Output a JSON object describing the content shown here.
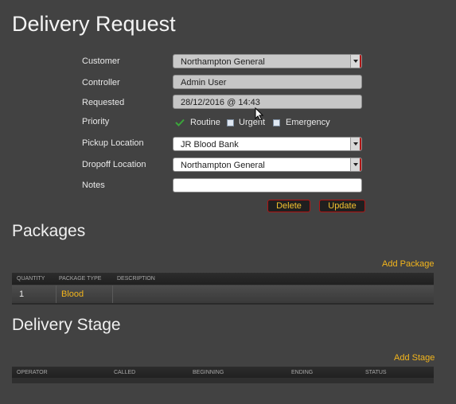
{
  "page": {
    "title": "Delivery Request"
  },
  "form": {
    "customer": {
      "label": "Customer",
      "value": "Northampton General"
    },
    "controller": {
      "label": "Controller",
      "value": "Admin User"
    },
    "requested": {
      "label": "Requested",
      "value": "28/12/2016 @ 14:43"
    },
    "priority": {
      "label": "Priority",
      "options": [
        "Routine",
        "Urgent",
        "Emergency"
      ],
      "selected": "Routine"
    },
    "pickup": {
      "label": "Pickup Location",
      "value": "JR Blood Bank"
    },
    "dropoff": {
      "label": "Dropoff Location",
      "value": "Northampton General"
    },
    "notes": {
      "label": "Notes",
      "value": ""
    },
    "delete_label": "Delete",
    "update_label": "Update"
  },
  "packages": {
    "title": "Packages",
    "add_label": "Add Package",
    "columns": [
      "QUANTITY",
      "PACKAGE TYPE",
      "DESCRIPTION"
    ],
    "rows": [
      {
        "quantity": "1",
        "package_type": "Blood",
        "description": ""
      }
    ]
  },
  "stages": {
    "title": "Delivery Stage",
    "add_label": "Add Stage",
    "columns": [
      "OPERATOR",
      "CALLED",
      "BEGINNING",
      "ENDING",
      "STATUS"
    ]
  },
  "colors": {
    "background": "#424242",
    "accent": "#f3b51c",
    "button_border": "#b11414",
    "check": "#3aa63a"
  }
}
